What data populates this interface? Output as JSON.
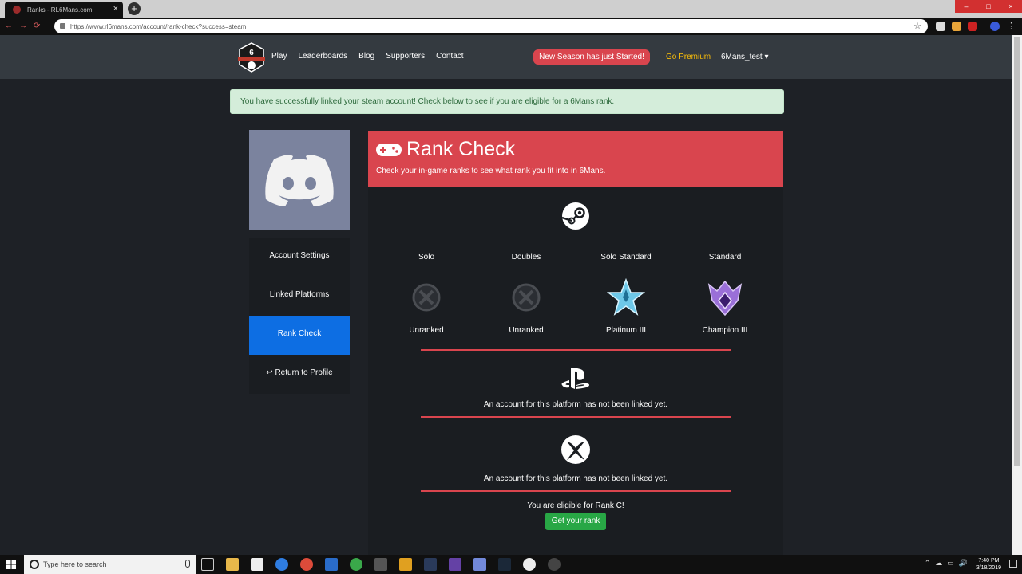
{
  "browser": {
    "tab_title": "Ranks - RL6Mans.com",
    "tab_close": "×",
    "new_tab": "+",
    "url": "https://www.rl6mans.com/account/rank-check?success=steam"
  },
  "nav": {
    "links": [
      "Play",
      "Leaderboards",
      "Blog",
      "Supporters",
      "Contact"
    ],
    "new_season": "New Season has just Started!",
    "premium": "Go Premium",
    "user": "6Mans_test"
  },
  "alert": "You have successfully linked your steam account! Check below to see if you are eligible for a 6Mans rank.",
  "sidebar": {
    "items": [
      "Account Settings",
      "Linked Platforms",
      "Rank Check",
      "Return to Profile"
    ],
    "active_index": 2
  },
  "card": {
    "title": "Rank Check",
    "subtitle": "Check your in-game ranks to see what rank you fit into in 6Mans."
  },
  "ranks": [
    {
      "playlist": "Solo",
      "rank": "Unranked",
      "icon": "unranked-icon"
    },
    {
      "playlist": "Doubles",
      "rank": "Unranked",
      "icon": "unranked-icon"
    },
    {
      "playlist": "Solo Standard",
      "rank": "Platinum III",
      "icon": "platinum-rank-icon"
    },
    {
      "playlist": "Standard",
      "rank": "Champion III",
      "icon": "champion-rank-icon"
    }
  ],
  "platforms": {
    "ps_msg": "An account for this platform has not been linked yet.",
    "xbox_msg": "An account for this platform has not been linked yet."
  },
  "eligibility": {
    "message": "You are eligible for Rank C!",
    "button": "Get your rank"
  },
  "taskbar": {
    "search_placeholder": "Type here to search",
    "time": "7:40 PM",
    "date": "3/18/2019"
  },
  "colors": {
    "accent_red": "#d9454e",
    "active_blue": "#0d6ee3",
    "success_green": "#28a745",
    "premium_yellow": "#ffc107"
  }
}
